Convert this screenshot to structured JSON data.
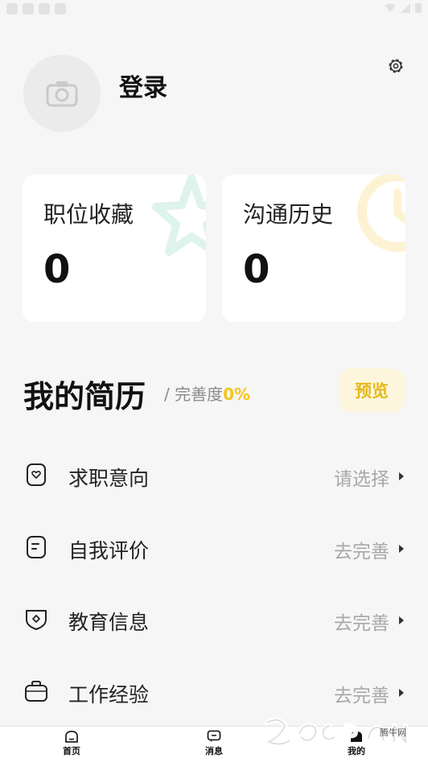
{
  "profile": {
    "login_label": "登录"
  },
  "stats": [
    {
      "title": "职位收藏",
      "count": "0"
    },
    {
      "title": "沟通历史",
      "count": "0"
    }
  ],
  "resume": {
    "title": "我的简历",
    "separator": "/",
    "completion_label": "完善度",
    "completion_percent": "0%",
    "preview_label": "预览"
  },
  "resume_items": [
    {
      "label": "求职意向",
      "action": "请选择",
      "icon": "heart-card-icon"
    },
    {
      "label": "自我评价",
      "action": "去完善",
      "icon": "document-icon"
    },
    {
      "label": "教育信息",
      "action": "去完善",
      "icon": "shield-icon"
    },
    {
      "label": "工作经验",
      "action": "去完善",
      "icon": "briefcase-icon"
    }
  ],
  "tabs": [
    {
      "label": "首页",
      "icon": "home-icon"
    },
    {
      "label": "消息",
      "icon": "message-icon"
    },
    {
      "label": "我的",
      "icon": "profile-icon"
    }
  ],
  "watermark": {
    "brand": "腾牛网"
  },
  "colors": {
    "accent": "#f3c51e",
    "preview_bg": "#fdf6dc",
    "background": "#f6f6f6"
  }
}
